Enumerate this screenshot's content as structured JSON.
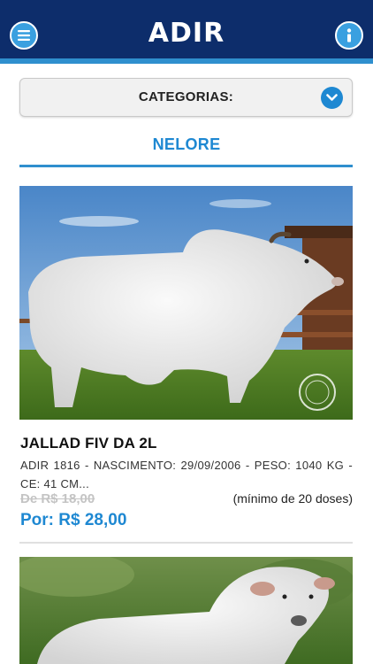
{
  "header": {
    "logo": "ADIR",
    "menu_icon": "menu-icon",
    "info_icon": "info-icon",
    "colors": {
      "bar": "#0d2d6b",
      "accent": "#2f8fce"
    }
  },
  "categories": {
    "label": "CATEGORIAS:",
    "dropdown_icon": "chevron-down-icon"
  },
  "section": {
    "title": "NELORE"
  },
  "products": [
    {
      "name": "JALLAD FIV DA 2L",
      "description": "ADIR 1816 - NASCIMENTO: 29/09/2006 - PESO: 1040 KG - CE: 41 CM...",
      "old_price": "De R$ 18,00",
      "min_doses": "(mínimo de 20 doses)",
      "price": "Por: R$ 28,00",
      "image": "white-nelore-bull-photo"
    },
    {
      "image": "white-nelore-bull-photo"
    }
  ],
  "accent_color": "#1e88d2"
}
